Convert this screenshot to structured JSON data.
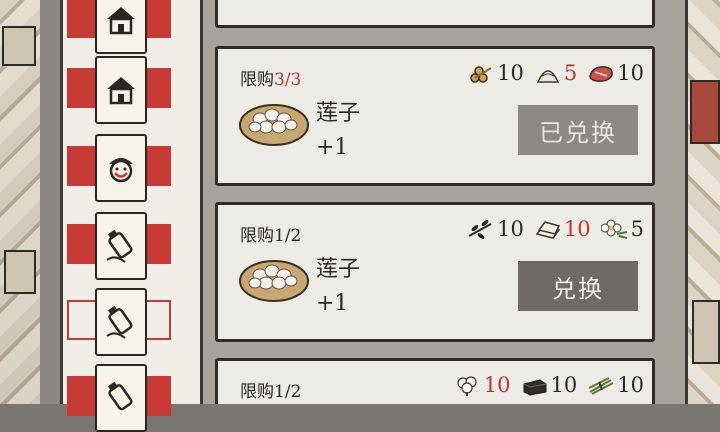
{
  "tabs": [
    {
      "name": "house-tab-1",
      "icon": "house-icon",
      "style": "filled"
    },
    {
      "name": "house-tab-2",
      "icon": "house-icon",
      "style": "filled"
    },
    {
      "name": "person-tab",
      "icon": "smiling-person-icon",
      "style": "filled"
    },
    {
      "name": "bottle-tab-1",
      "icon": "bottle-icon",
      "style": "filled"
    },
    {
      "name": "bottle-tab-2",
      "icon": "bottle-icon",
      "style": "outlined"
    },
    {
      "name": "bottle-tab-3",
      "icon": "bottle-icon",
      "style": "filled"
    }
  ],
  "rows": [
    {
      "limit_label": "限购",
      "limit_value": "3/3",
      "limit_red": true,
      "item_name": "莲子",
      "item_qty": "+1",
      "item_icon": "lotus-seed-basket-icon",
      "costs": [
        {
          "icon": "wood-logs-icon",
          "value": "10",
          "red": false
        },
        {
          "icon": "flour-icon",
          "value": "5",
          "red": true
        },
        {
          "icon": "meat-icon",
          "value": "10",
          "red": false
        }
      ],
      "button_label": "已兑换",
      "button_state": "redeemed"
    },
    {
      "limit_label": "限购",
      "limit_value": "1/2",
      "limit_red": false,
      "item_name": "莲子",
      "item_qty": "+1",
      "item_icon": "lotus-seed-basket-icon",
      "costs": [
        {
          "icon": "herb-branch-icon",
          "value": "10",
          "red": false
        },
        {
          "icon": "paper-stack-icon",
          "value": "10",
          "red": true
        },
        {
          "icon": "white-flower-icon",
          "value": "5",
          "red": false
        }
      ],
      "button_label": "兑换",
      "button_state": "available"
    },
    {
      "limit_label": "限购",
      "limit_value": "1/2",
      "limit_red": false,
      "costs": [
        {
          "icon": "cotton-icon",
          "value": "10",
          "red": true
        },
        {
          "icon": "ink-block-icon",
          "value": "10",
          "red": false
        },
        {
          "icon": "grass-bundle-icon",
          "value": "10",
          "red": false
        }
      ]
    }
  ],
  "colors": {
    "accent_red": "#c83a35",
    "button_gray": "#6f6a66",
    "panel_bg": "#ecebe6"
  }
}
